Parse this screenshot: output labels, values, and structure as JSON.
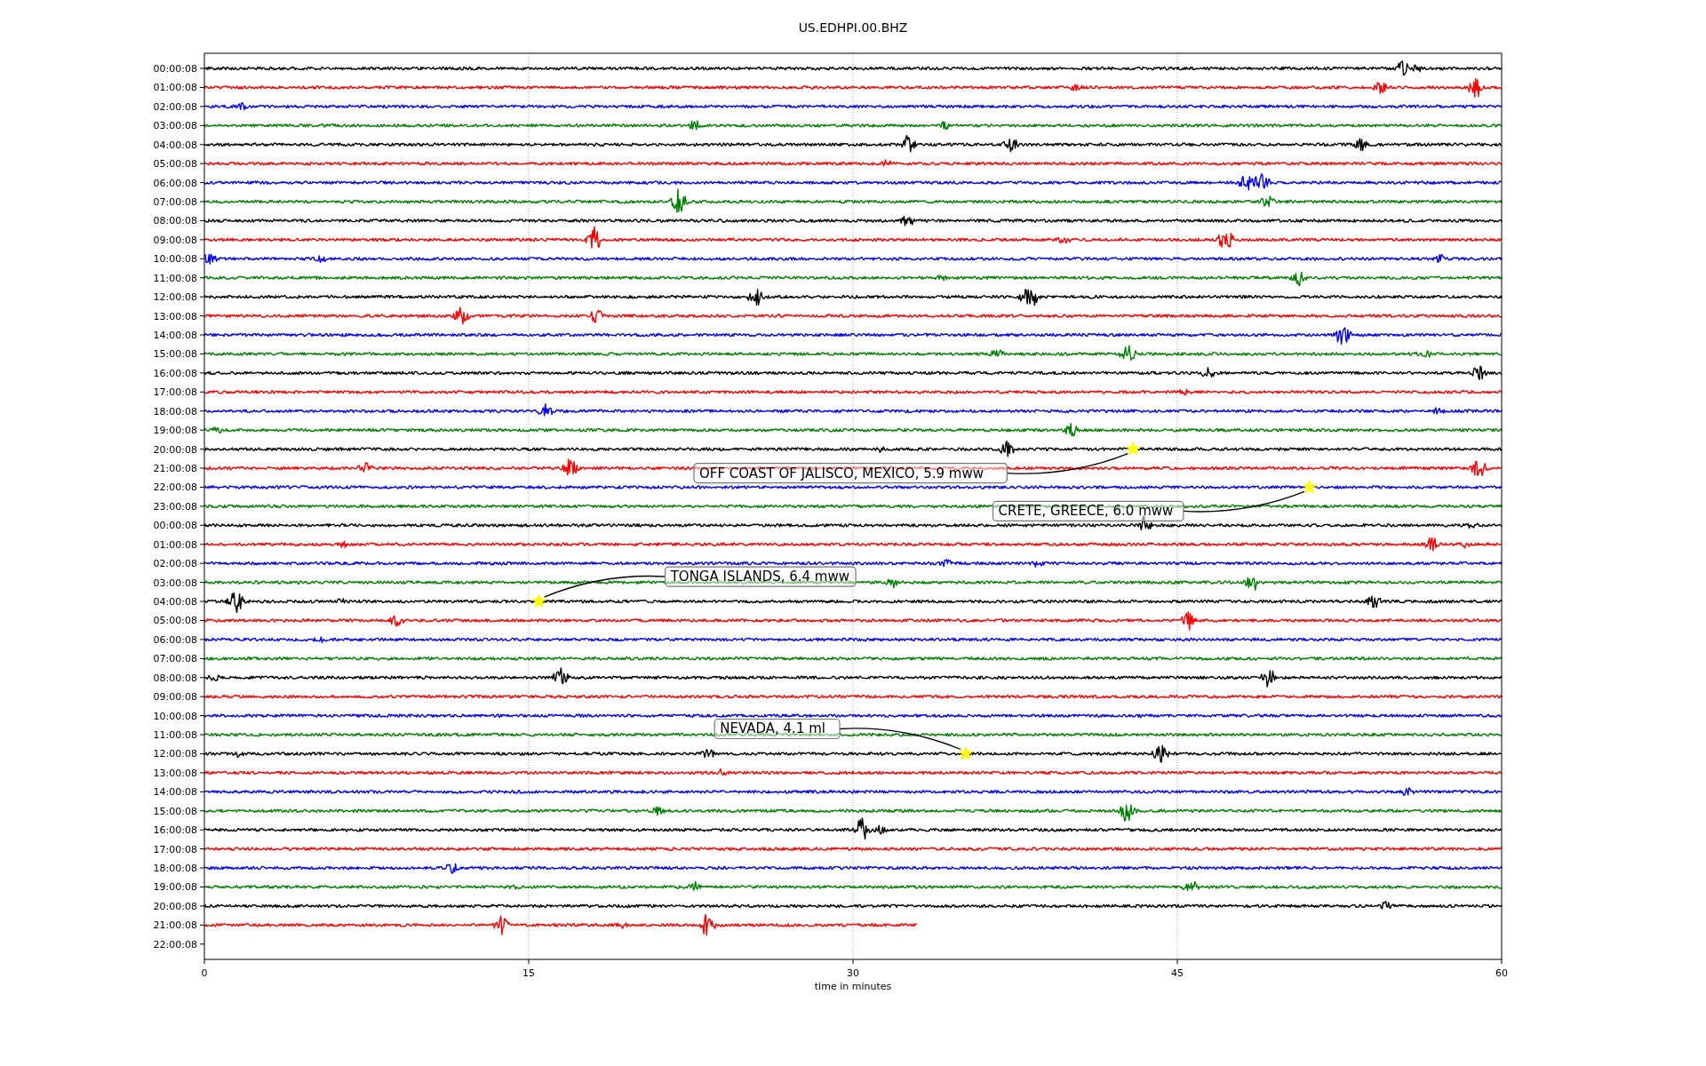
{
  "plot": {
    "title": "US.EDHPI.00.BHZ",
    "xlabel": "time in minutes",
    "xticks": [
      "0",
      "15",
      "30",
      "45",
      "60"
    ],
    "rows": [
      {
        "label": "00:00:08",
        "color": "#000000"
      },
      {
        "label": "01:00:08",
        "color": "#ff0000"
      },
      {
        "label": "02:00:08",
        "color": "#0000ff"
      },
      {
        "label": "03:00:08",
        "color": "#008000"
      },
      {
        "label": "04:00:08",
        "color": "#000000"
      },
      {
        "label": "05:00:08",
        "color": "#ff0000"
      },
      {
        "label": "06:00:08",
        "color": "#0000ff"
      },
      {
        "label": "07:00:08",
        "color": "#008000"
      },
      {
        "label": "08:00:08",
        "color": "#000000"
      },
      {
        "label": "09:00:08",
        "color": "#ff0000"
      },
      {
        "label": "10:00:08",
        "color": "#0000ff"
      },
      {
        "label": "11:00:08",
        "color": "#008000"
      },
      {
        "label": "12:00:08",
        "color": "#000000"
      },
      {
        "label": "13:00:08",
        "color": "#ff0000"
      },
      {
        "label": "14:00:08",
        "color": "#0000ff"
      },
      {
        "label": "15:00:08",
        "color": "#008000"
      },
      {
        "label": "16:00:08",
        "color": "#000000"
      },
      {
        "label": "17:00:08",
        "color": "#ff0000"
      },
      {
        "label": "18:00:08",
        "color": "#0000ff"
      },
      {
        "label": "19:00:08",
        "color": "#008000"
      },
      {
        "label": "20:00:08",
        "color": "#000000",
        "event": {
          "text": "OFF COAST OF JALISCO, MEXICO, 5.9 mww",
          "kind": "lower",
          "level": 0.716
        }
      },
      {
        "label": "21:00:08",
        "color": "#ff0000"
      },
      {
        "label": "22:00:08",
        "color": "#0000ff",
        "event": {
          "text": "CRETE, GREECE, 6.0 mww",
          "kind": "lower",
          "level": 0.852
        }
      },
      {
        "label": "23:00:08",
        "color": "#008000"
      },
      {
        "label": "00:00:08",
        "color": "#000000"
      },
      {
        "label": "01:00:08",
        "color": "#ff0000"
      },
      {
        "label": "02:00:08",
        "color": "#0000ff"
      },
      {
        "label": "03:00:08",
        "color": "#008000"
      },
      {
        "label": "04:00:08",
        "color": "#000000",
        "event": {
          "text": "TONGA ISLANDS, 6.4 mww",
          "kind": "upper",
          "level": 0.258
        }
      },
      {
        "label": "05:00:08",
        "color": "#ff0000"
      },
      {
        "label": "06:00:08",
        "color": "#0000ff"
      },
      {
        "label": "07:00:08",
        "color": "#008000"
      },
      {
        "label": "08:00:08",
        "color": "#000000"
      },
      {
        "label": "09:00:08",
        "color": "#ff0000"
      },
      {
        "label": "10:00:08",
        "color": "#0000ff"
      },
      {
        "label": "11:00:08",
        "color": "#008000"
      },
      {
        "label": "12:00:08",
        "color": "#000000",
        "event": {
          "text": "NEVADA, 4.1 ml",
          "kind": "upper",
          "level": 0.587
        }
      },
      {
        "label": "13:00:08",
        "color": "#ff0000"
      },
      {
        "label": "14:00:08",
        "color": "#0000ff"
      },
      {
        "label": "15:00:08",
        "color": "#008000"
      },
      {
        "label": "16:00:08",
        "color": "#000000"
      },
      {
        "label": "17:00:08",
        "color": "#ff0000"
      },
      {
        "label": "18:00:08",
        "color": "#0000ff"
      },
      {
        "label": "19:00:08",
        "color": "#008000"
      },
      {
        "label": "20:00:08",
        "color": "#000000"
      },
      {
        "label": "21:00:08",
        "color": "#ff0000",
        "partial": true
      },
      {
        "label": "22:00:08"
      }
    ]
  }
}
